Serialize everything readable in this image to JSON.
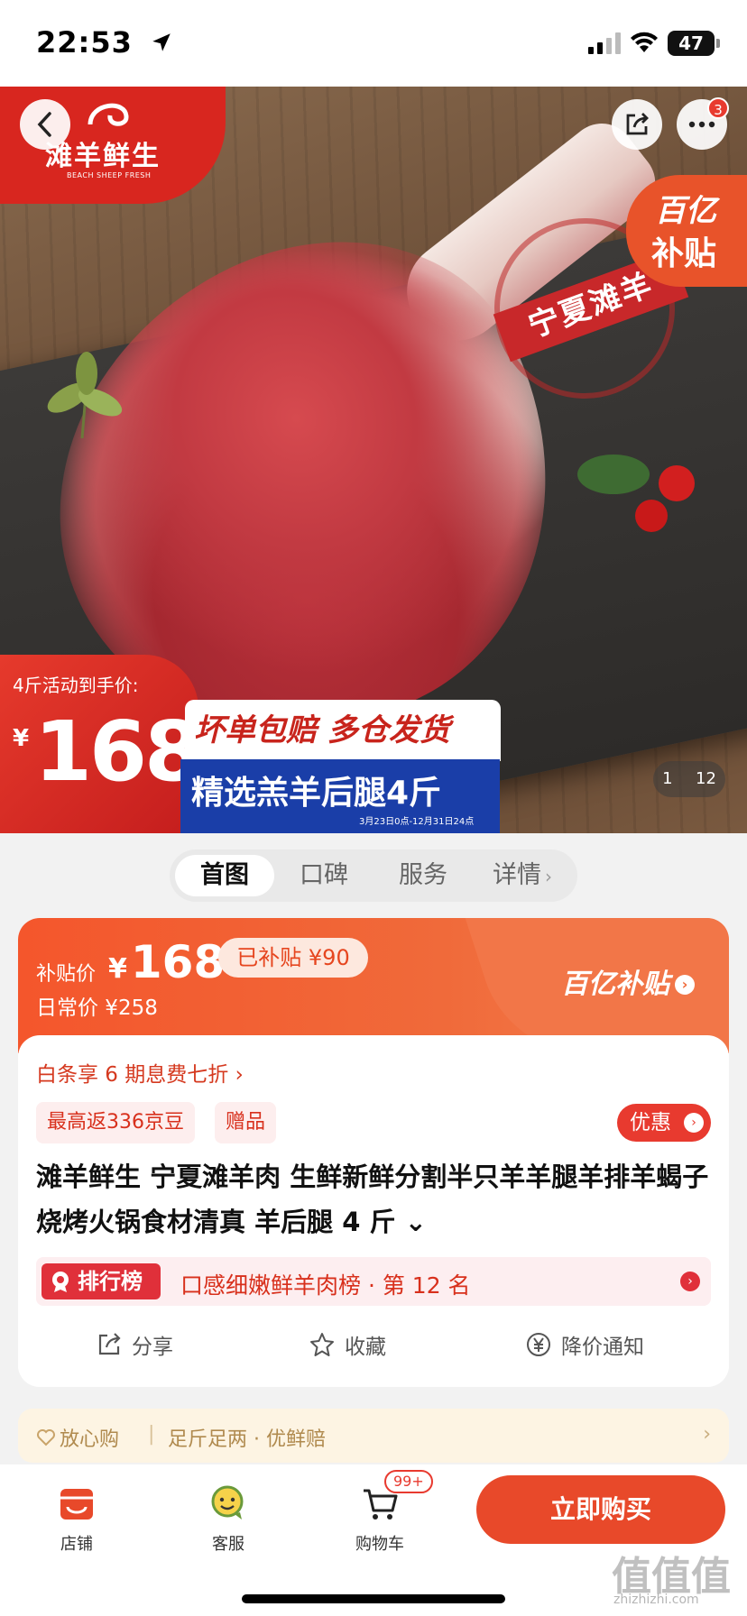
{
  "status_bar": {
    "time": "22:53",
    "battery": "47"
  },
  "hero": {
    "brand_name": "滩羊鲜生",
    "brand_sub": "BEACH SHEEP FRESH",
    "more_badge": "3",
    "stamp_text": "宁夏滩羊",
    "subsidy_line1": "百亿",
    "subsidy_line2": "补贴",
    "price_label": "4斤活动到手价:",
    "price_yen": "¥",
    "price_value": "168",
    "promo_white": "坏单包赔 多仓发货",
    "promo_blue": "精选羔羊后腿4斤",
    "promo_date": "3月23日0点-12月31日24点",
    "image_index": "1",
    "image_total": "12"
  },
  "tabs": [
    {
      "label": "首图",
      "active": true
    },
    {
      "label": "口碑",
      "active": false
    },
    {
      "label": "服务",
      "active": false
    },
    {
      "label": "详情",
      "active": false
    }
  ],
  "price_card": {
    "subsidy_label": "补贴价",
    "subsidy_yen": "¥",
    "subsidy_price": "168",
    "saved_pill": "已补贴 ¥90",
    "daily_price": "日常价 ¥258",
    "brand_subsidy": "百亿补贴"
  },
  "product": {
    "installment": "白条享 6 期息费七折 ›",
    "chip_beans": "最高返336京豆",
    "chip_gift": "赠品",
    "coupon_label": "优惠",
    "title": "滩羊鲜生 宁夏滩羊肉 生鲜新鲜分割半只羊羊腿羊排羊蝎子烧烤火锅食材清真 羊后腿 4 斤 ⌄",
    "rank_tag": "排行榜",
    "rank_text": "口感细嫩鲜羊肉榜 · 第 12 名",
    "action_share": "分享",
    "action_favorite": "收藏",
    "action_notify": "降价通知"
  },
  "assurance": {
    "label": "放心购",
    "items": "足斤足两 · 优鲜赔"
  },
  "bottom_bar": {
    "shop": "店铺",
    "service": "客服",
    "cart": "购物车",
    "cart_badge": "99+",
    "buy": "立即购买"
  },
  "watermark": {
    "main": "值值值",
    "sub": "zhizhizhi.com"
  },
  "colors": {
    "accent_red": "#e8492a",
    "subsidy_orange": "#f4562c",
    "brand_red": "#d8261f",
    "promo_blue": "#1a3ea8"
  }
}
